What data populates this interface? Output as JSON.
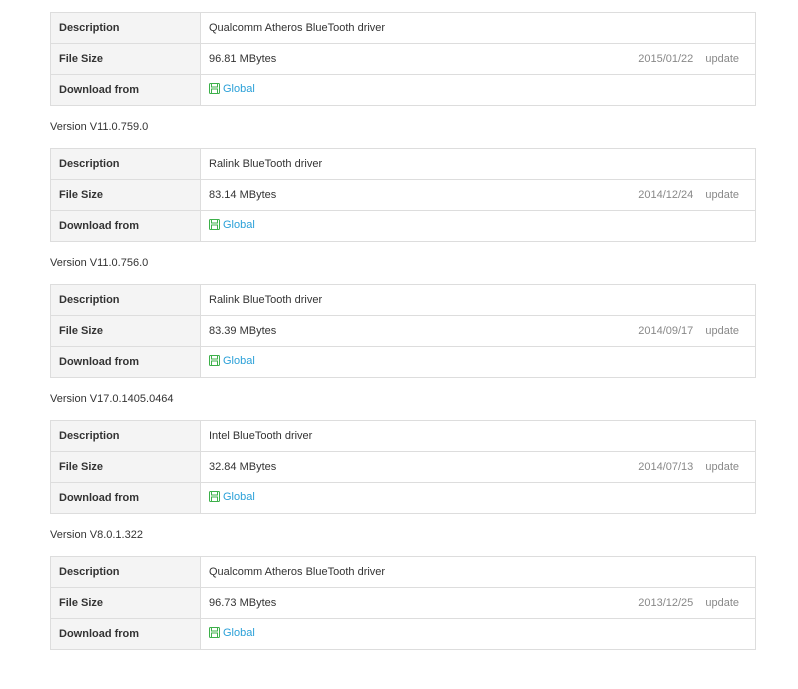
{
  "labels": {
    "description": "Description",
    "file_size": "File Size",
    "download_from": "Download from",
    "update": "update"
  },
  "colors": {
    "link": "#2aa0d8",
    "icon": "#3db04a"
  },
  "drivers": [
    {
      "version": "",
      "description": "Qualcomm Atheros BlueTooth driver",
      "file_size": "96.81 MBytes",
      "date": "2015/01/22",
      "download_link": "Global",
      "icon": "floppy-save-icon"
    },
    {
      "version": "Version V11.0.759.0",
      "description": "Ralink BlueTooth driver",
      "file_size": "83.14 MBytes",
      "date": "2014/12/24",
      "download_link": "Global",
      "icon": "floppy-save-icon"
    },
    {
      "version": "Version V11.0.756.0",
      "description": "Ralink BlueTooth driver",
      "file_size": "83.39 MBytes",
      "date": "2014/09/17",
      "download_link": "Global",
      "icon": "floppy-save-icon"
    },
    {
      "version": "Version V17.0.1405.0464",
      "description": "Intel BlueTooth driver",
      "file_size": "32.84 MBytes",
      "date": "2014/07/13",
      "download_link": "Global",
      "icon": "floppy-save-icon"
    },
    {
      "version": "Version V8.0.1.322",
      "description": "Qualcomm Atheros BlueTooth driver",
      "file_size": "96.73 MBytes",
      "date": "2013/12/25",
      "download_link": "Global",
      "icon": "floppy-save-icon"
    }
  ]
}
